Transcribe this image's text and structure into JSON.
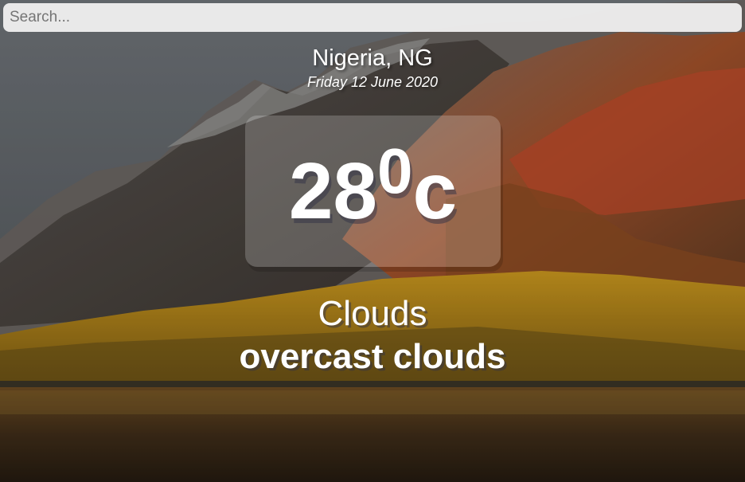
{
  "search": {
    "placeholder": "Search...",
    "value": ""
  },
  "location": {
    "name": "Nigeria, NG",
    "date": "Friday 12 June 2020"
  },
  "weather": {
    "temperature": "28",
    "degree_symbol": "0",
    "unit": "c",
    "main": "Clouds",
    "description": "overcast clouds"
  },
  "colors": {
    "text": "#ffffff",
    "temp_box_bg": "rgba(255,255,255,0.20)",
    "search_bg": "#f0f0f0"
  },
  "background": {
    "scene": "mountain-lake-autumn-landscape"
  }
}
